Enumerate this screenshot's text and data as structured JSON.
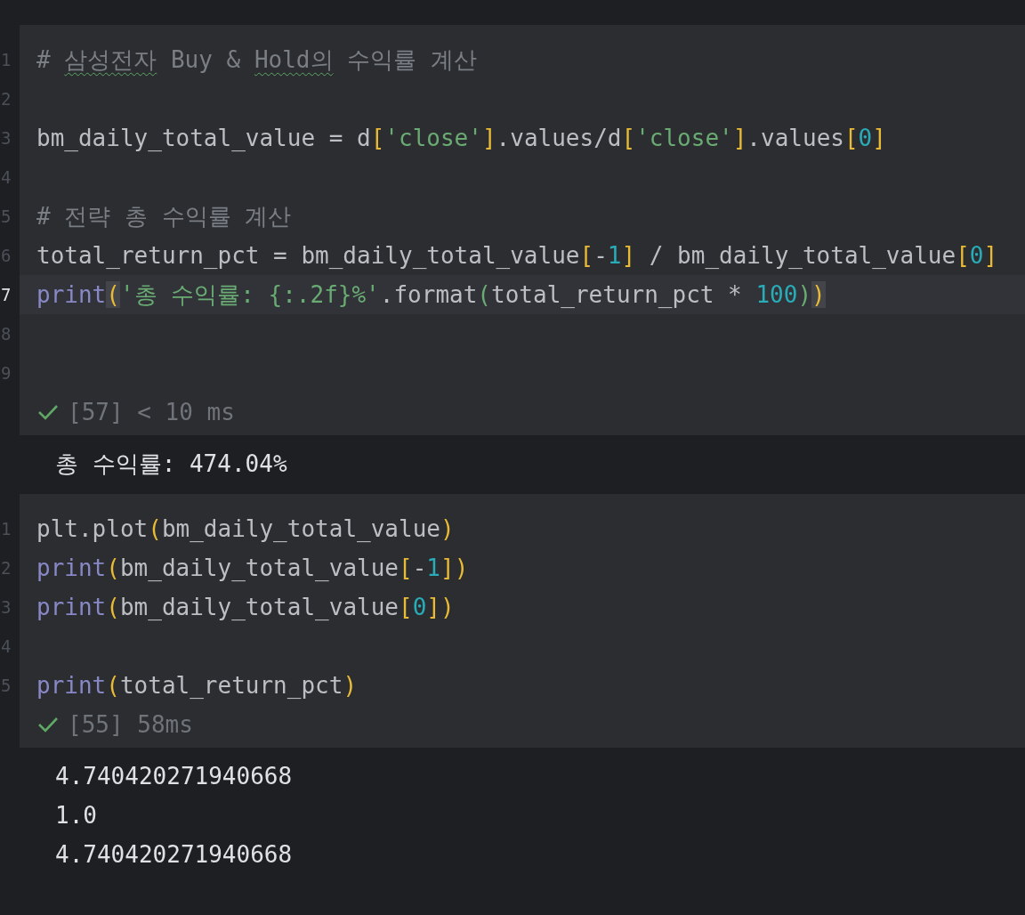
{
  "cells": [
    {
      "lines": [
        {
          "number": "1",
          "current": false,
          "tokens": [
            {
              "kind": "comment",
              "text": "# "
            },
            {
              "kind": "comment_typo",
              "text": "삼성전자"
            },
            {
              "kind": "comment",
              "text": " Buy & "
            },
            {
              "kind": "comment_typo",
              "text": "Hold의"
            },
            {
              "kind": "comment",
              "text": " 수익률 계산"
            }
          ]
        },
        {
          "number": "2",
          "current": false
        },
        {
          "number": "3",
          "current": false,
          "tokens": [
            {
              "kind": "plain",
              "text": "bm_daily_total_value = d"
            },
            {
              "kind": "bracket",
              "text": "["
            },
            {
              "kind": "string",
              "text": "'close'"
            },
            {
              "kind": "bracket",
              "text": "]"
            },
            {
              "kind": "plain",
              "text": ".values/d"
            },
            {
              "kind": "bracket",
              "text": "["
            },
            {
              "kind": "string",
              "text": "'close'"
            },
            {
              "kind": "bracket",
              "text": "]"
            },
            {
              "kind": "plain",
              "text": ".values"
            },
            {
              "kind": "bracket",
              "text": "["
            },
            {
              "kind": "number",
              "text": "0"
            },
            {
              "kind": "bracket",
              "text": "]"
            }
          ]
        },
        {
          "number": "4",
          "current": false
        },
        {
          "number": "5",
          "current": false,
          "tokens": [
            {
              "kind": "comment",
              "text": "# 전략 총 수익률 계산"
            }
          ]
        },
        {
          "number": "6",
          "current": false,
          "tokens": [
            {
              "kind": "plain",
              "text": "total_return_pct = bm_daily_total_value"
            },
            {
              "kind": "bracket",
              "text": "["
            },
            {
              "kind": "plain",
              "text": "-"
            },
            {
              "kind": "number",
              "text": "1"
            },
            {
              "kind": "bracket",
              "text": "]"
            },
            {
              "kind": "plain",
              "text": " / bm_daily_total_value"
            },
            {
              "kind": "bracket",
              "text": "["
            },
            {
              "kind": "number",
              "text": "0"
            },
            {
              "kind": "bracket",
              "text": "]"
            }
          ]
        },
        {
          "number": "7",
          "current": true,
          "tokens": [
            {
              "kind": "builtin",
              "text": "print"
            },
            {
              "kind": "bracket_match",
              "text": "("
            },
            {
              "kind": "string",
              "text": "'총 수익률: {:.2f}%'"
            },
            {
              "kind": "plain",
              "text": ".format"
            },
            {
              "kind": "bracket2",
              "text": "("
            },
            {
              "kind": "plain",
              "text": "total_return_pct * "
            },
            {
              "kind": "number",
              "text": "100"
            },
            {
              "kind": "bracket2",
              "text": ")"
            },
            {
              "kind": "bracket_match",
              "text": ")"
            }
          ]
        },
        {
          "number": "8",
          "current": false
        },
        {
          "number": "9",
          "current": false
        }
      ],
      "status": "[57] < 10 ms",
      "output": [
        "총 수익률: 474.04%"
      ]
    },
    {
      "lines": [
        {
          "number": "1",
          "current": false,
          "tokens": [
            {
              "kind": "plain",
              "text": "plt.plot"
            },
            {
              "kind": "bracket",
              "text": "("
            },
            {
              "kind": "plain",
              "text": "bm_daily_total_value"
            },
            {
              "kind": "bracket",
              "text": ")"
            }
          ]
        },
        {
          "number": "2",
          "current": false,
          "tokens": [
            {
              "kind": "builtin",
              "text": "print"
            },
            {
              "kind": "bracket",
              "text": "("
            },
            {
              "kind": "plain",
              "text": "bm_daily_total_value"
            },
            {
              "kind": "bracket",
              "text": "["
            },
            {
              "kind": "plain",
              "text": "-"
            },
            {
              "kind": "number",
              "text": "1"
            },
            {
              "kind": "bracket",
              "text": "]"
            },
            {
              "kind": "bracket",
              "text": ")"
            }
          ]
        },
        {
          "number": "3",
          "current": false,
          "tokens": [
            {
              "kind": "builtin",
              "text": "print"
            },
            {
              "kind": "bracket",
              "text": "("
            },
            {
              "kind": "plain",
              "text": "bm_daily_total_value"
            },
            {
              "kind": "bracket",
              "text": "["
            },
            {
              "kind": "number",
              "text": "0"
            },
            {
              "kind": "bracket",
              "text": "]"
            },
            {
              "kind": "bracket",
              "text": ")"
            }
          ]
        },
        {
          "number": "4",
          "current": false
        },
        {
          "number": "5",
          "current": false,
          "tokens": [
            {
              "kind": "builtin",
              "text": "print"
            },
            {
              "kind": "bracket",
              "text": "("
            },
            {
              "kind": "plain",
              "text": "total_return_pct"
            },
            {
              "kind": "bracket",
              "text": ")"
            }
          ]
        }
      ],
      "status": "[55] 58ms",
      "output": [
        "4.740420271940668",
        "1.0",
        "4.740420271940668"
      ]
    }
  ]
}
